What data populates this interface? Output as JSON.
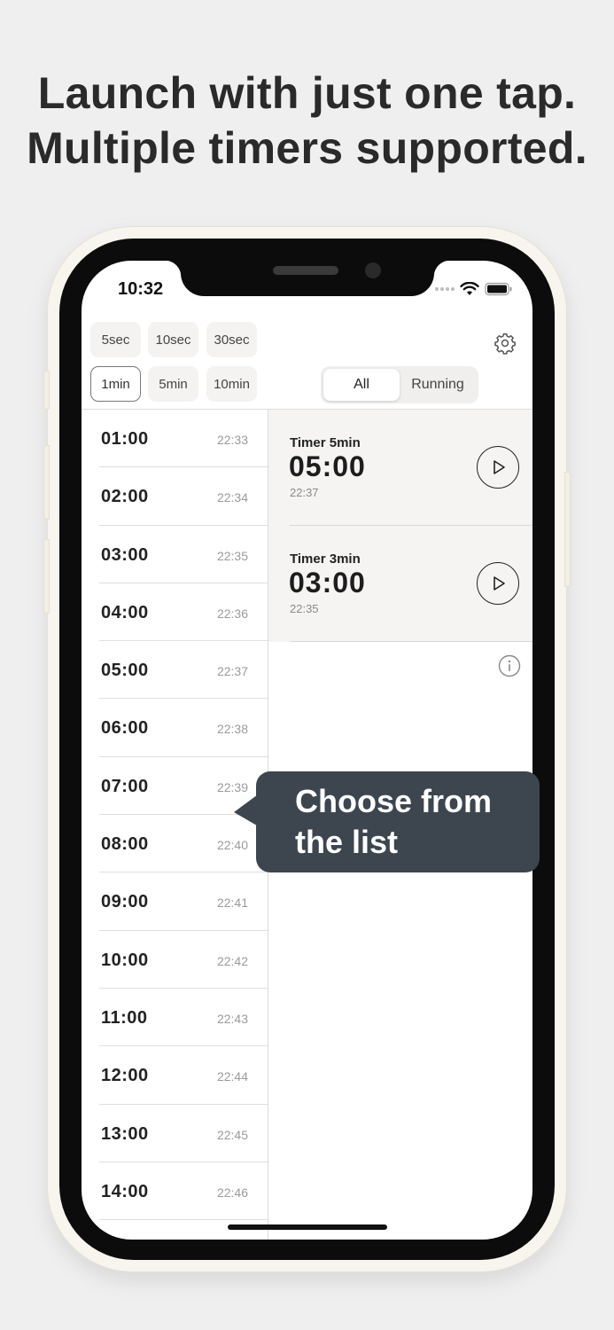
{
  "headline": {
    "line1": "Launch with just one tap.",
    "line2": "Multiple timers supported."
  },
  "status_bar": {
    "time": "10:32",
    "icons": [
      "signal-dots-icon",
      "wifi-icon",
      "battery-icon"
    ]
  },
  "presets": {
    "row1": [
      "5sec",
      "10sec",
      "30sec"
    ],
    "row2": [
      "1min",
      "5min",
      "10min"
    ],
    "selected": "1min"
  },
  "filter": {
    "options": [
      "All",
      "Running"
    ],
    "selected": "All"
  },
  "durations": [
    {
      "duration": "01:00",
      "ends_at": "22:33"
    },
    {
      "duration": "02:00",
      "ends_at": "22:34"
    },
    {
      "duration": "03:00",
      "ends_at": "22:35"
    },
    {
      "duration": "04:00",
      "ends_at": "22:36"
    },
    {
      "duration": "05:00",
      "ends_at": "22:37"
    },
    {
      "duration": "06:00",
      "ends_at": "22:38"
    },
    {
      "duration": "07:00",
      "ends_at": "22:39"
    },
    {
      "duration": "08:00",
      "ends_at": "22:40"
    },
    {
      "duration": "09:00",
      "ends_at": "22:41"
    },
    {
      "duration": "10:00",
      "ends_at": "22:42"
    },
    {
      "duration": "11:00",
      "ends_at": "22:43"
    },
    {
      "duration": "12:00",
      "ends_at": "22:44"
    },
    {
      "duration": "13:00",
      "ends_at": "22:45"
    },
    {
      "duration": "14:00",
      "ends_at": "22:46"
    }
  ],
  "timers": [
    {
      "name": "Timer 5min",
      "remaining": "05:00",
      "ends_at": "22:37"
    },
    {
      "name": "Timer 3min",
      "remaining": "03:00",
      "ends_at": "22:35"
    }
  ],
  "callout": {
    "line1": "Choose from",
    "line2": "the list"
  },
  "colors": {
    "callout_bg": "#3d464f",
    "frame": "#f7f5ed",
    "background": "#efefef"
  }
}
